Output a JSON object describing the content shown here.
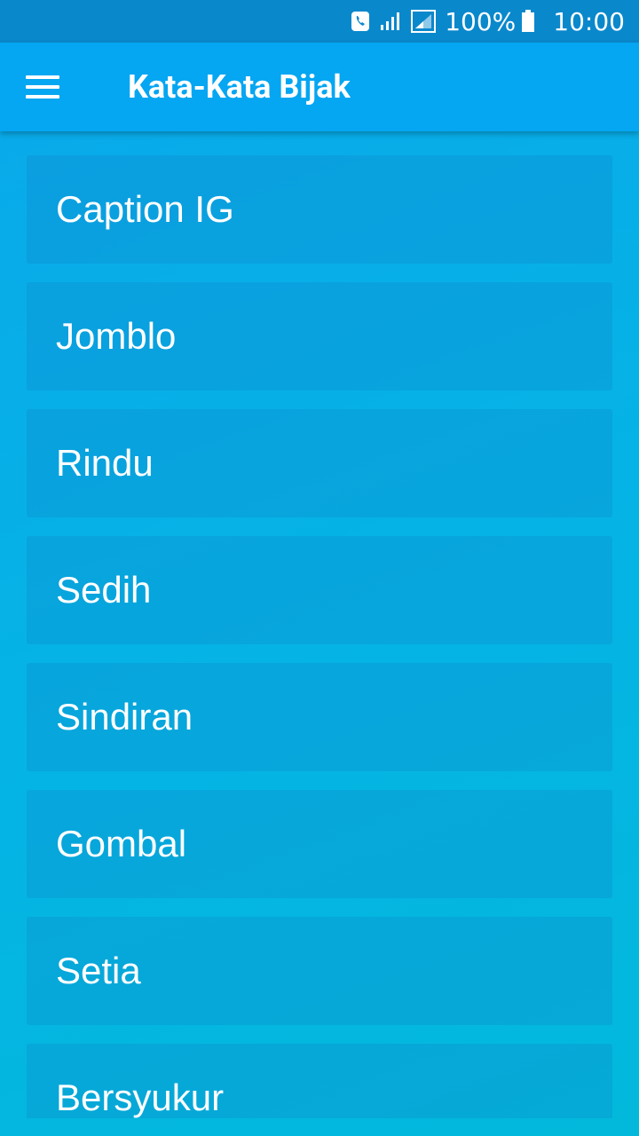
{
  "status_bar": {
    "battery_percent": "100%",
    "time": "10:00",
    "icons": [
      "phone-wifi-call-icon",
      "signal-icon",
      "sim-signal-icon",
      "battery-icon"
    ]
  },
  "app_bar": {
    "title": "Kata-Kata Bijak",
    "menu_icon": "hamburger-menu-icon"
  },
  "categories": [
    {
      "label": "Caption IG"
    },
    {
      "label": "Jomblo"
    },
    {
      "label": "Rindu"
    },
    {
      "label": "Sedih"
    },
    {
      "label": "Sindiran"
    },
    {
      "label": "Gombal"
    },
    {
      "label": "Setia"
    },
    {
      "label": "Bersyukur"
    }
  ],
  "colors": {
    "status_bar": "#0a88cc",
    "app_bar": "#05a6f2",
    "background": "#05b3e6",
    "text": "#ffffff"
  }
}
